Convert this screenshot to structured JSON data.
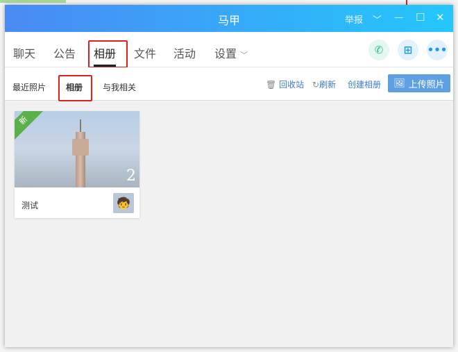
{
  "window": {
    "title": "马甲",
    "report": "举报"
  },
  "tabs": [
    {
      "label": "聊天"
    },
    {
      "label": "公告"
    },
    {
      "label": "相册"
    },
    {
      "label": "文件"
    },
    {
      "label": "活动"
    },
    {
      "label": "设置"
    }
  ],
  "subtabs": [
    {
      "label": "最近照片"
    },
    {
      "label": "相册"
    },
    {
      "label": "与我相关"
    }
  ],
  "actions": {
    "recycle": "回收站",
    "refresh": "刷新",
    "create": "创建相册",
    "upload": "上传照片"
  },
  "album": {
    "name": "测试",
    "count": "2",
    "badge": "新"
  }
}
